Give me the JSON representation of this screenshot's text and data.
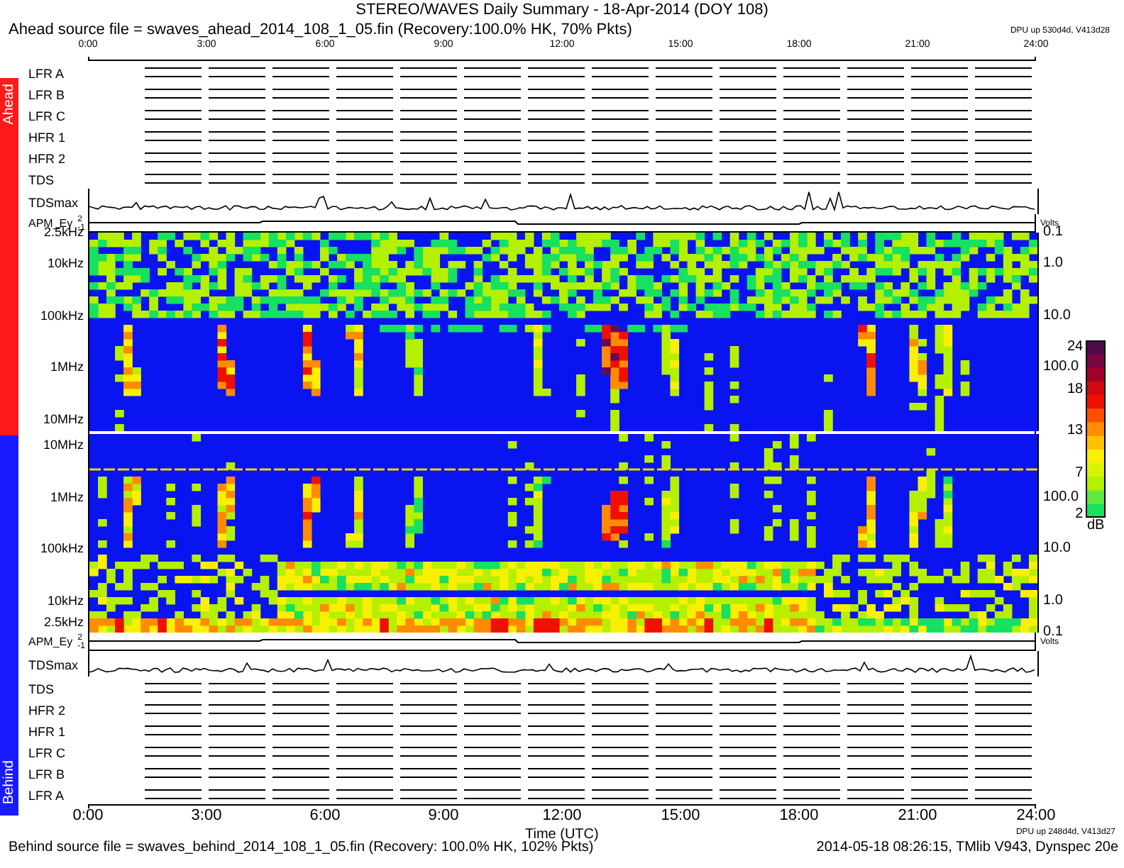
{
  "title": "STEREO/WAVES Daily Summary - 18-Apr-2014 (DOY 108)",
  "ahead": {
    "side_label": "Ahead",
    "source": "Ahead source file = swaves_ahead_2014_108_1_05.fin (Recovery:100.0% HK, 70% Pkts)",
    "dpu": "DPU up 530d4d, V413d28",
    "time_ticks": [
      "0:00",
      "3:00",
      "6:00",
      "9:00",
      "12:00",
      "15:00",
      "18:00",
      "21:00",
      "24:00"
    ],
    "instruments": [
      {
        "name": "LFR A"
      },
      {
        "name": "LFR B"
      },
      {
        "name": "LFR C"
      },
      {
        "name": "HFR 1"
      },
      {
        "name": "HFR 2"
      },
      {
        "name": "TDS"
      }
    ],
    "tdsmax": {
      "label": "TDSmax"
    },
    "apm": {
      "label": "APM_Ey",
      "ticks": [
        "2",
        "-1"
      ],
      "unit": "Volts"
    },
    "freq_ticks": [
      "2.5kHz",
      "10kHz",
      "100kHz",
      "1MHz",
      "10MHz"
    ],
    "right_ticks": [
      "0.1",
      "1.0",
      "10.0",
      "100.0"
    ]
  },
  "behind": {
    "side_label": "Behind",
    "source": "Behind source file = swaves_behind_2014_108_1_05.fin (Recovery: 100.0% HK, 102% Pkts)",
    "dpu": "DPU up 248d4d, V413d27",
    "time_ticks": [
      "0:00",
      "3:00",
      "6:00",
      "9:00",
      "12:00",
      "15:00",
      "18:00",
      "21:00",
      "24:00"
    ],
    "time_label": "Time (UTC)",
    "instruments": [
      {
        "name": "TDS"
      },
      {
        "name": "HFR 2"
      },
      {
        "name": "HFR 1"
      },
      {
        "name": "LFR C"
      },
      {
        "name": "LFR B"
      },
      {
        "name": "LFR A"
      }
    ],
    "tdsmax": {
      "label": "TDSmax"
    },
    "apm": {
      "label": "APM_Ey",
      "ticks": [
        "2",
        "-1"
      ],
      "unit": "Volts"
    },
    "freq_ticks": [
      "10MHz",
      "1MHz",
      "100kHz",
      "10kHz",
      "2.5kHz"
    ],
    "right_ticks": [
      "100.0",
      "10.0",
      "1.0",
      "0.1"
    ]
  },
  "colorbar": {
    "ticks": [
      "24",
      "18",
      "13",
      "7",
      "2"
    ],
    "unit": "dB"
  },
  "stamp": "2014-05-18 08:26:15, TMlib V943, Dynspec 20e"
}
